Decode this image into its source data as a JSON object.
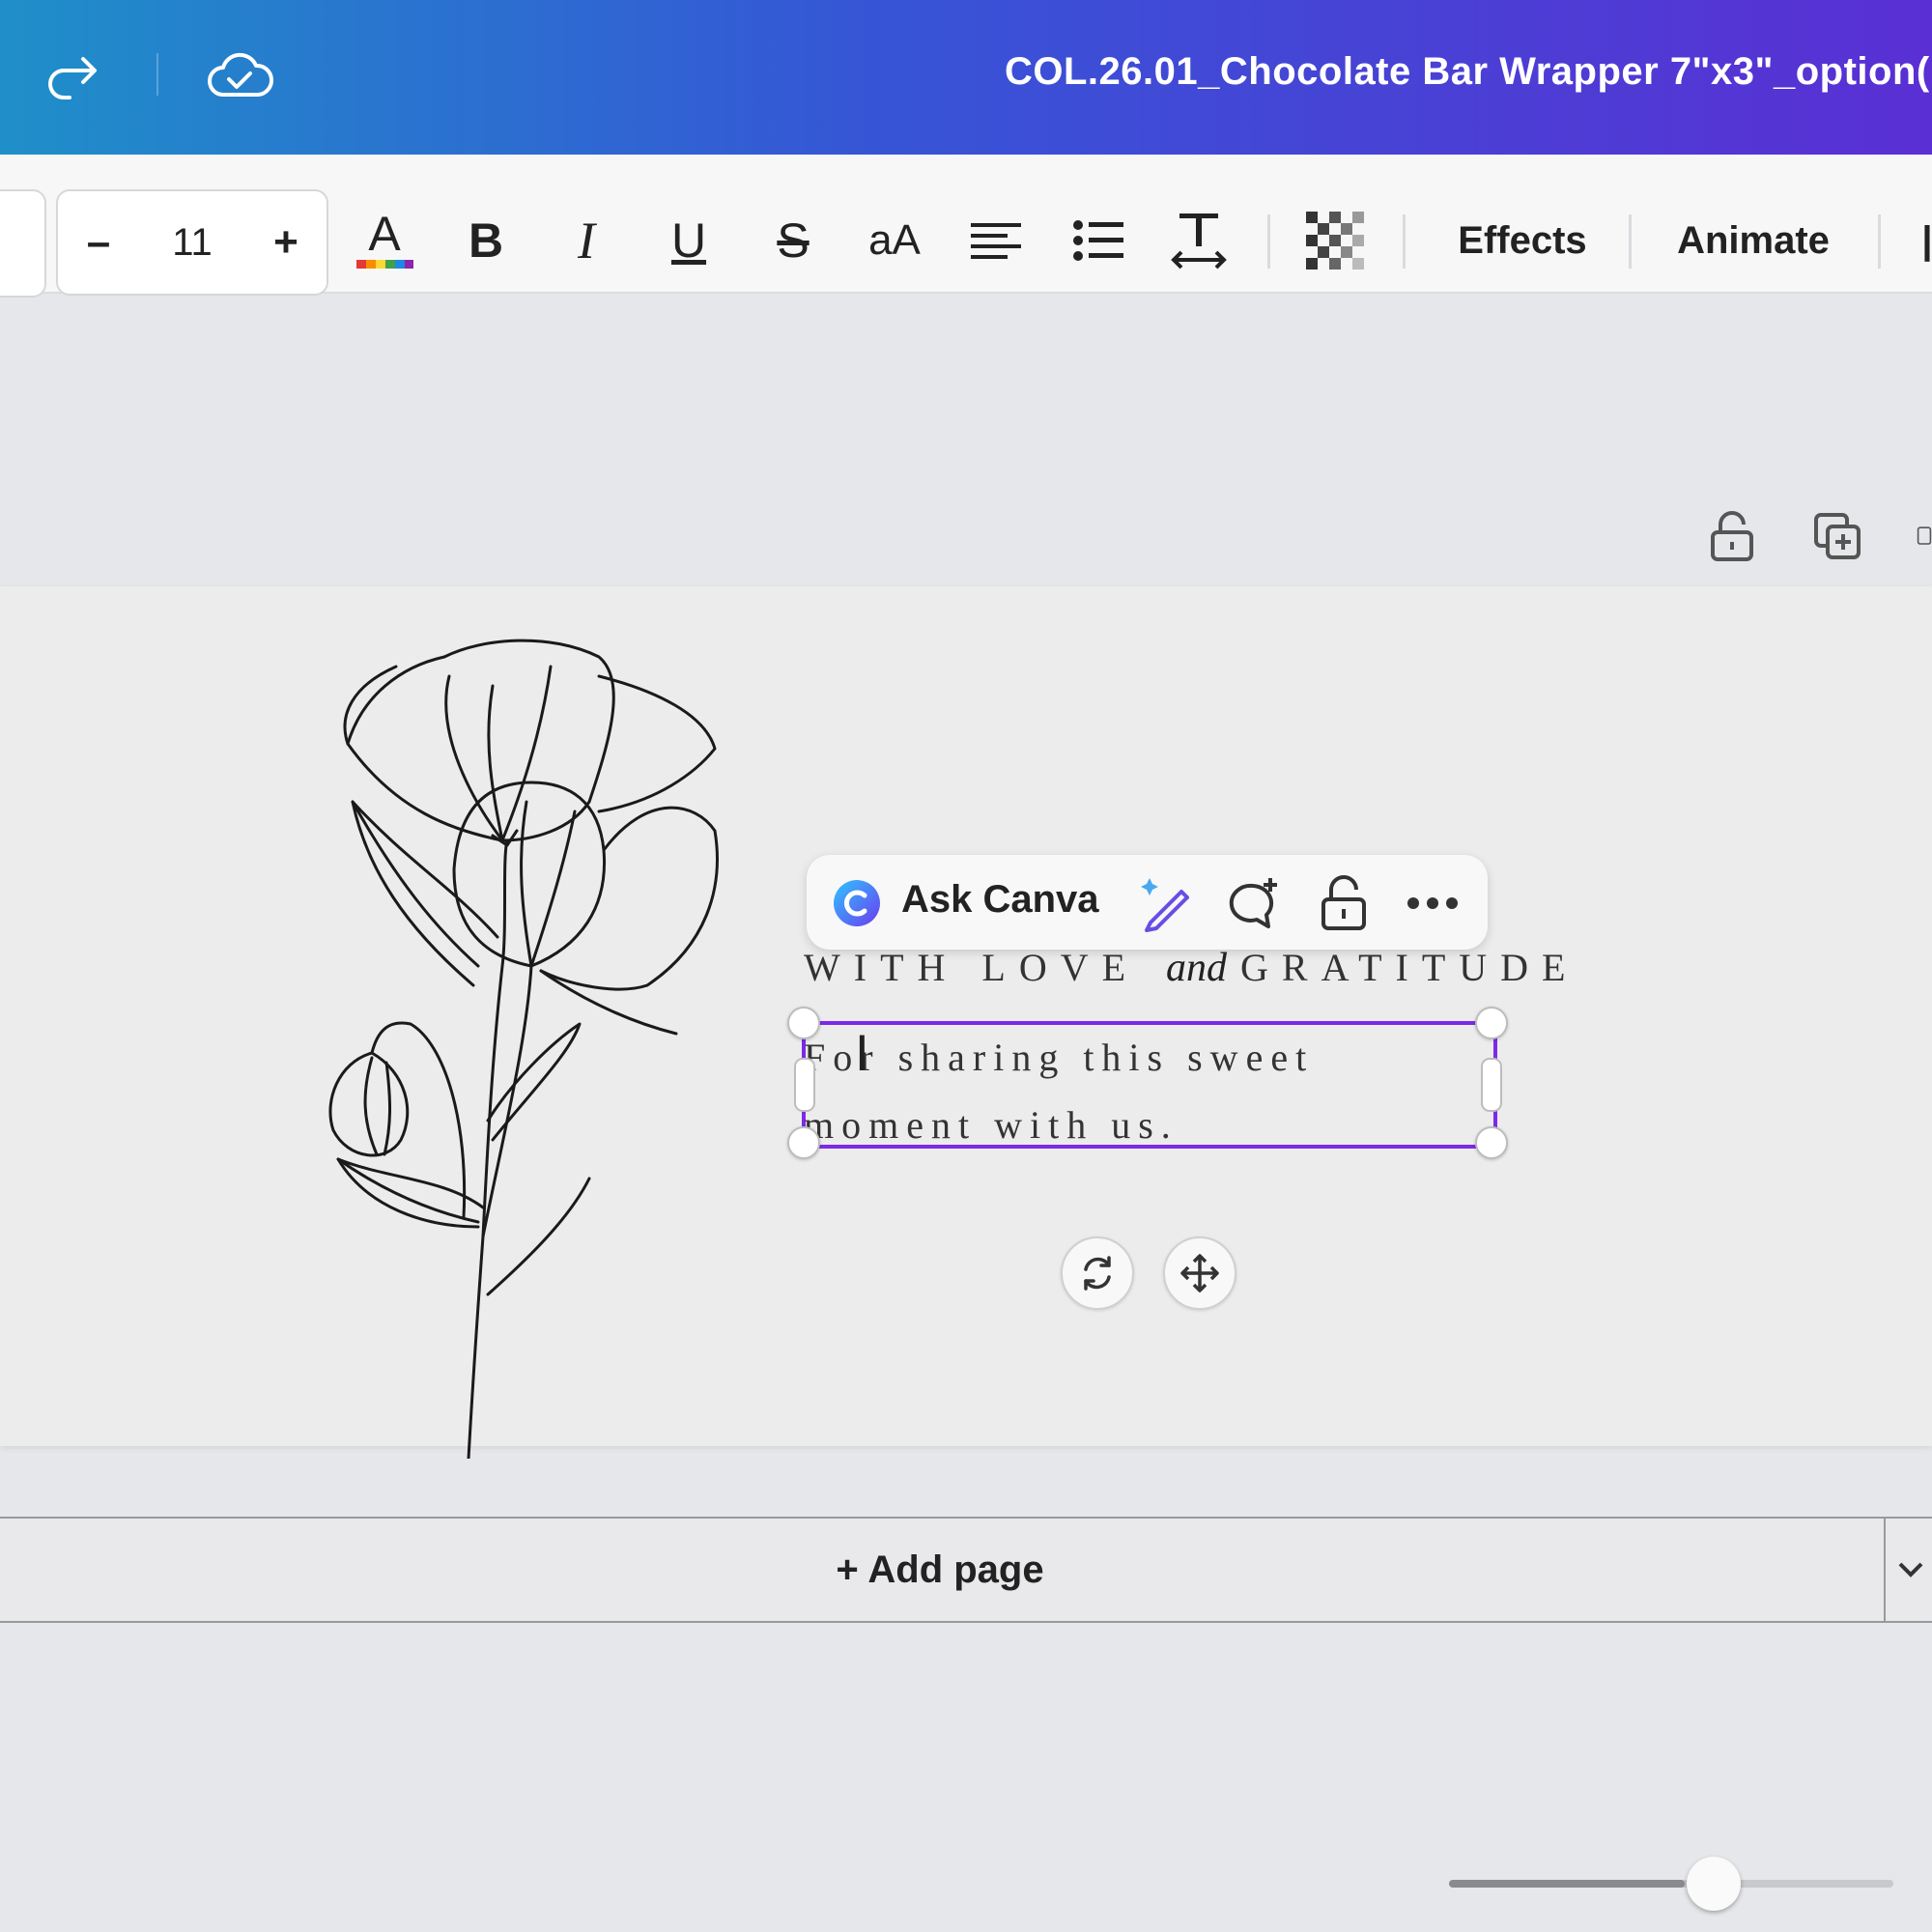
{
  "header": {
    "doc_title": "COL.26.01_Chocolate Bar Wrapper 7\"x3\"_option(",
    "icons": [
      "redo-icon",
      "cloud-saved-icon"
    ]
  },
  "toolbar": {
    "font_size": "11",
    "decrease_label": "–",
    "increase_label": "+",
    "case_label": "aA",
    "effects_label": "Effects",
    "animate_label": "Animate",
    "icons": [
      "text-color-icon",
      "bold-icon",
      "italic-icon",
      "underline-icon",
      "strikethrough-icon",
      "letter-case-icon",
      "align-left-icon",
      "list-icon",
      "spacing-icon",
      "transparency-icon"
    ]
  },
  "page_tools": {
    "icons": [
      "lock-icon",
      "duplicate-page-icon",
      "add-page-icon"
    ]
  },
  "floating_toolbar": {
    "ask_label": "Ask Canva",
    "icons": [
      "canva-assistant-icon",
      "magic-edit-icon",
      "comment-add-icon",
      "lock-icon",
      "more-icon"
    ]
  },
  "design": {
    "headline_left": "WITH LOVE",
    "headline_script": "and",
    "headline_right": "GRATITUDE",
    "body_line1": "For sharing this sweet",
    "body_line2": "moment with us."
  },
  "canvas_controls": {
    "icons": [
      "rotate-icon",
      "move-icon"
    ]
  },
  "footer": {
    "add_page_label": "+ Add page"
  },
  "zoom": {
    "level_fraction": 0.53
  },
  "colors": {
    "header_gradient_start": "#1f8fc9",
    "header_gradient_end": "#5a2fd4",
    "selection": "#7d2ae8",
    "text_color_bar": [
      "#e53935",
      "#fb8c00",
      "#fdd835",
      "#43a047",
      "#1e88e5",
      "#8e24aa"
    ]
  }
}
